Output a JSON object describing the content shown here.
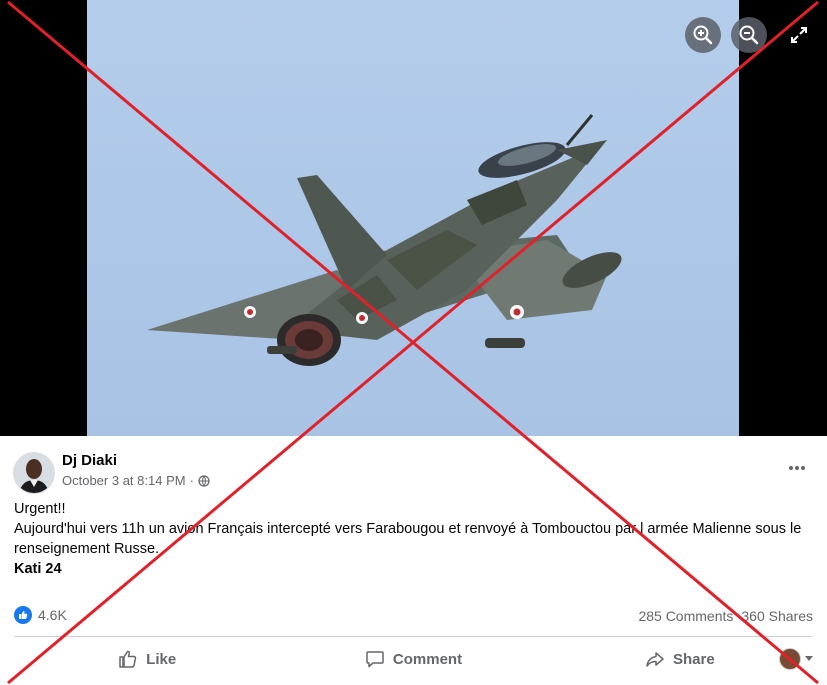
{
  "post": {
    "author": "Dj Diaki",
    "timestamp": "October 3 at 8:14 PM",
    "separator": "·",
    "text_lines": [
      "Urgent!!",
      "Aujourd'hui vers 11h un avion Français intercepté vers Farabougou et renvoyé à Tombouctou par l armée Malienne sous le renseignement Russe."
    ],
    "signature": "Kati 24"
  },
  "stats": {
    "reactions": "4.6K",
    "comments": "285 Comments",
    "shares": "360 Shares"
  },
  "actions": {
    "like": "Like",
    "comment": "Comment",
    "share": "Share"
  },
  "icons": {
    "zoom_in": "zoom-in-icon",
    "zoom_out": "zoom-out-icon",
    "fullscreen": "fullscreen-icon",
    "privacy": "globe-icon",
    "more": "more-options-icon",
    "like_badge": "thumbs-up-icon"
  },
  "colors": {
    "facebook_blue": "#1877f2",
    "cross_red": "#e0212a",
    "secondary_text": "#65676b"
  }
}
